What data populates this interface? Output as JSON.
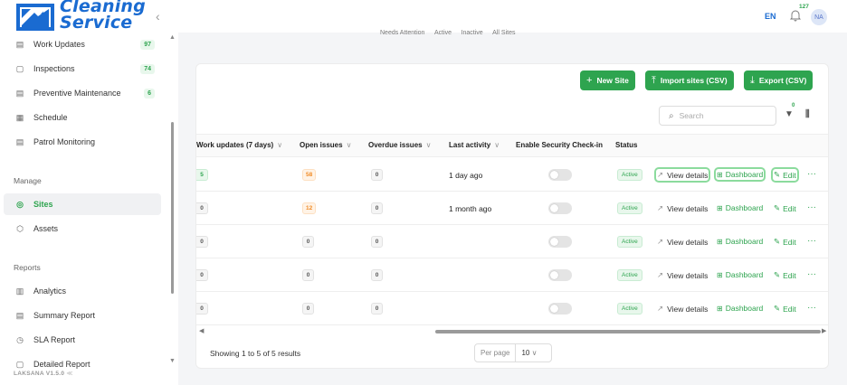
{
  "brand": {
    "line1": "Cleaning",
    "line2": "Service",
    "version": "LAKSANA V1.5.0"
  },
  "topbar": {
    "lang": "EN",
    "notifications": "127",
    "avatar": "NA"
  },
  "tabs_strip": [
    "Needs Attention",
    "Active",
    "Inactive",
    "All Sites"
  ],
  "sidebar": {
    "items_top": [
      {
        "label": "Work Updates",
        "count": "97",
        "icon": "clipboard-icon"
      },
      {
        "label": "Inspections",
        "count": "74",
        "icon": "inspection-icon"
      },
      {
        "label": "Preventive Maintenance",
        "count": "6",
        "icon": "maintenance-icon"
      },
      {
        "label": "Schedule",
        "count": "",
        "icon": "calendar-icon"
      },
      {
        "label": "Patrol Monitoring",
        "count": "",
        "icon": "patrol-icon"
      }
    ],
    "manage_title": "Manage",
    "manage_items": [
      {
        "label": "Sites",
        "icon": "map-pin-icon",
        "active": true
      },
      {
        "label": "Assets",
        "icon": "box-icon"
      }
    ],
    "reports_title": "Reports",
    "reports_items": [
      {
        "label": "Analytics",
        "icon": "bar-chart-icon"
      },
      {
        "label": "Summary Report",
        "icon": "report-icon"
      },
      {
        "label": "SLA Report",
        "icon": "clock-icon"
      },
      {
        "label": "Detailed Report",
        "icon": "document-icon"
      }
    ]
  },
  "toolbar": {
    "new_site": "New Site",
    "import": "Import sites (CSV)",
    "export": "Export (CSV)",
    "search_placeholder": "Search",
    "filter_badge": "0"
  },
  "table": {
    "headers": [
      "Work updates (7 days)",
      "Open issues",
      "Overdue issues",
      "Last activity",
      "Enable Security Check-in",
      "Status"
    ],
    "rows": [
      {
        "work_updates": "5",
        "open_issues": "58",
        "overdue": "0",
        "last_activity": "1 day ago",
        "status": "Active"
      },
      {
        "work_updates": "0",
        "open_issues": "12",
        "overdue": "0",
        "last_activity": "1 month ago",
        "status": "Active"
      },
      {
        "work_updates": "0",
        "open_issues": "0",
        "overdue": "0",
        "last_activity": "",
        "status": "Active"
      },
      {
        "work_updates": "0",
        "open_issues": "0",
        "overdue": "0",
        "last_activity": "",
        "status": "Active"
      },
      {
        "work_updates": "0",
        "open_issues": "0",
        "overdue": "0",
        "last_activity": "",
        "status": "Active"
      }
    ],
    "actions": {
      "view": "View details",
      "dashboard": "Dashboard",
      "edit": "Edit",
      "more": "···"
    }
  },
  "footer": {
    "showing": "Showing 1 to 5 of 5 results",
    "per_page_label": "Per page",
    "per_page_value": "10"
  },
  "colors": {
    "brand": "#1a6bd1",
    "accent": "#2ea44f",
    "warning": "#f08a24"
  }
}
